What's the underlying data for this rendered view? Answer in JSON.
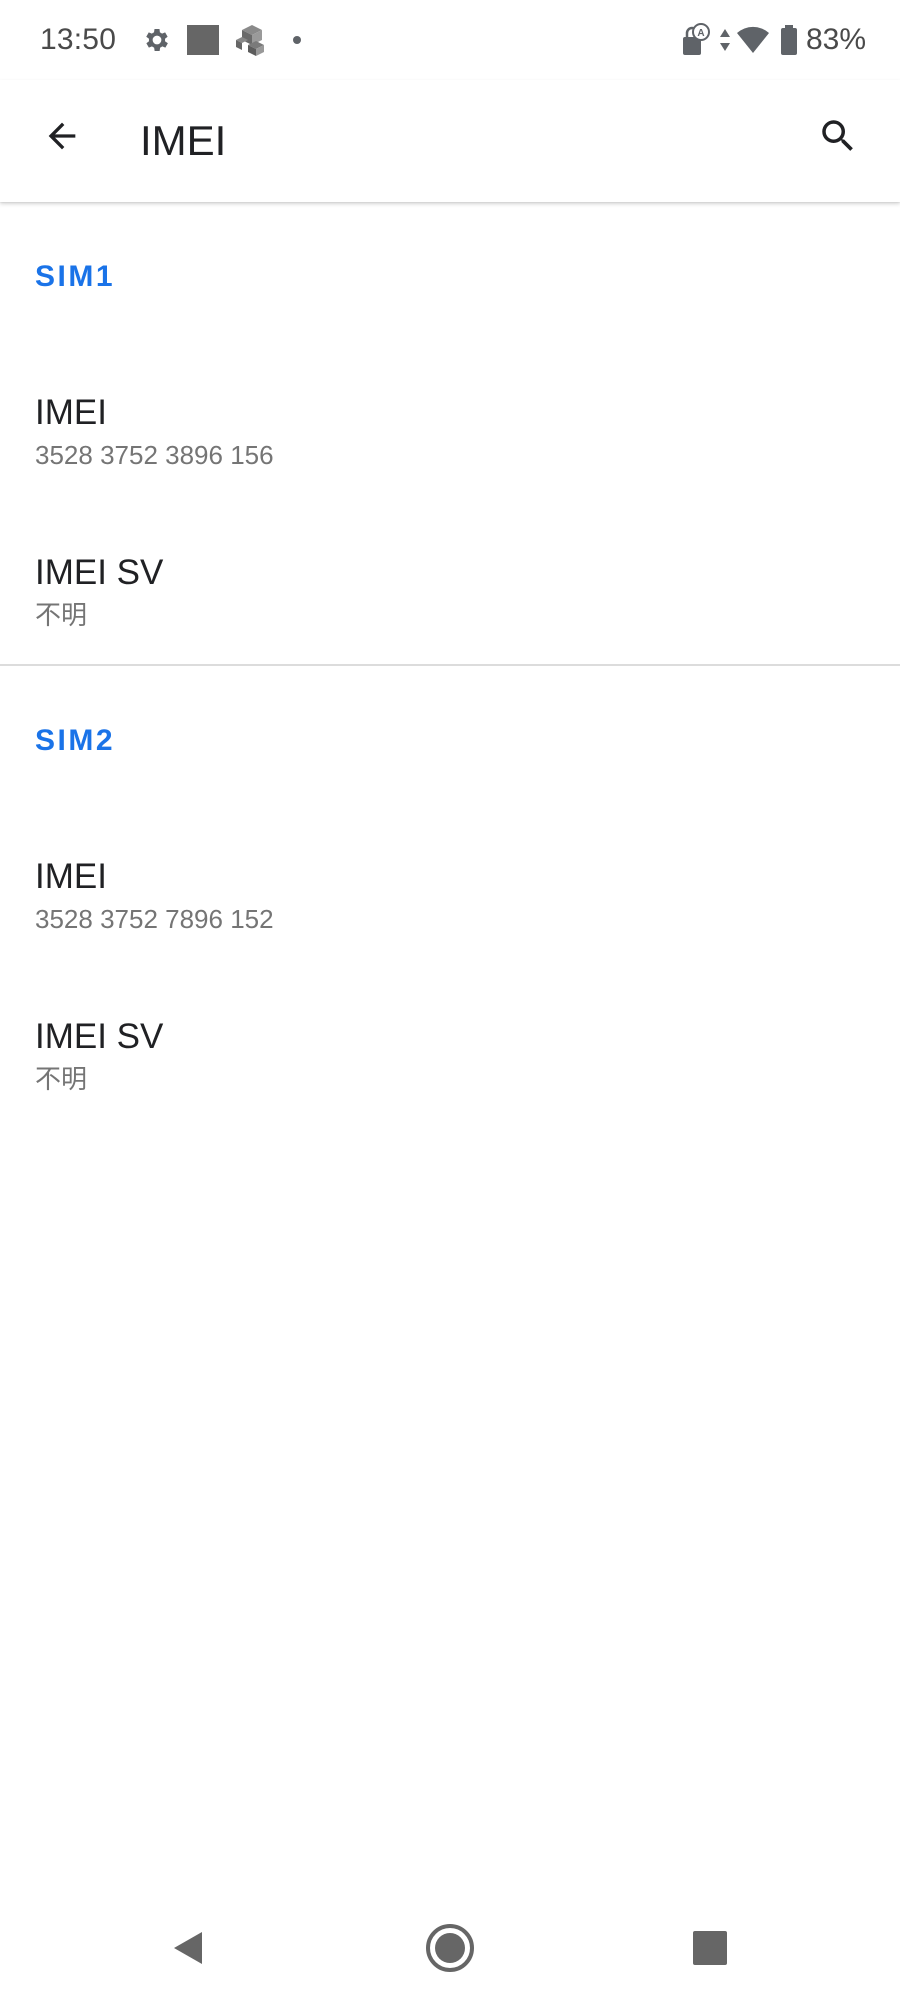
{
  "status_bar": {
    "time": "13:50",
    "battery_percent": "83%",
    "left_icons": [
      "settings-gear-icon",
      "square-app-icon",
      "cubes-app-icon",
      "notification-dot-icon"
    ],
    "right_icons": [
      "lock-accessibility-icon",
      "data-arrows-icon",
      "wifi-icon",
      "battery-icon"
    ]
  },
  "app_bar": {
    "title": "IMEI",
    "back_icon": "arrow-back-icon",
    "search_icon": "search-icon"
  },
  "sections": [
    {
      "header": "SIM1",
      "items": [
        {
          "title": "IMEI",
          "summary": "3528 3752 3896 156"
        },
        {
          "title": "IMEI SV",
          "summary": "不明"
        }
      ]
    },
    {
      "header": "SIM2",
      "items": [
        {
          "title": "IMEI",
          "summary": "3528 3752 7896 152"
        },
        {
          "title": "IMEI SV",
          "summary": "不明"
        }
      ]
    }
  ],
  "nav_bar": {
    "back": "nav-back-triangle-icon",
    "home": "nav-home-circle-icon",
    "recents": "nav-recents-square-icon"
  },
  "colors": {
    "accent": "#1a73e8",
    "title_text": "#202124",
    "summary_text": "#757575",
    "icon_gray": "#5f6368",
    "divider": "#dcdcdc"
  }
}
